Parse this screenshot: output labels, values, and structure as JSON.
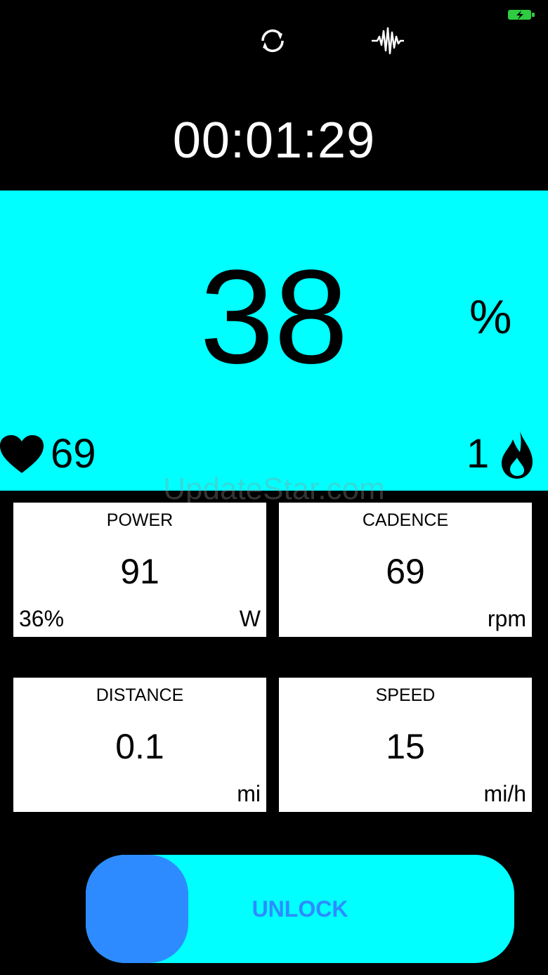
{
  "header": {
    "timer": "00:01:29"
  },
  "zone": {
    "value": "38",
    "unit": "%",
    "color": "#00ffff"
  },
  "heart_rate": {
    "value": "69",
    "icon": "heart-icon"
  },
  "calories": {
    "value": "1",
    "icon": "flame-icon"
  },
  "watermark": "UpdateStar.com",
  "tiles": {
    "power": {
      "label": "POWER",
      "value": "91",
      "unit": "W",
      "sub": "36%"
    },
    "cadence": {
      "label": "CADENCE",
      "value": "69",
      "unit": "rpm"
    },
    "distance": {
      "label": "DISTANCE",
      "value": "0.1",
      "unit": "mi"
    },
    "speed": {
      "label": "SPEED",
      "value": "15",
      "unit": "mi/h"
    }
  },
  "slider": {
    "label": "UNLOCK",
    "track_color": "#00ffff",
    "thumb_color": "#2d8bff"
  },
  "icons": {
    "sync": "sync-icon",
    "waveform": "waveform-icon",
    "battery": "battery-charging-icon"
  }
}
